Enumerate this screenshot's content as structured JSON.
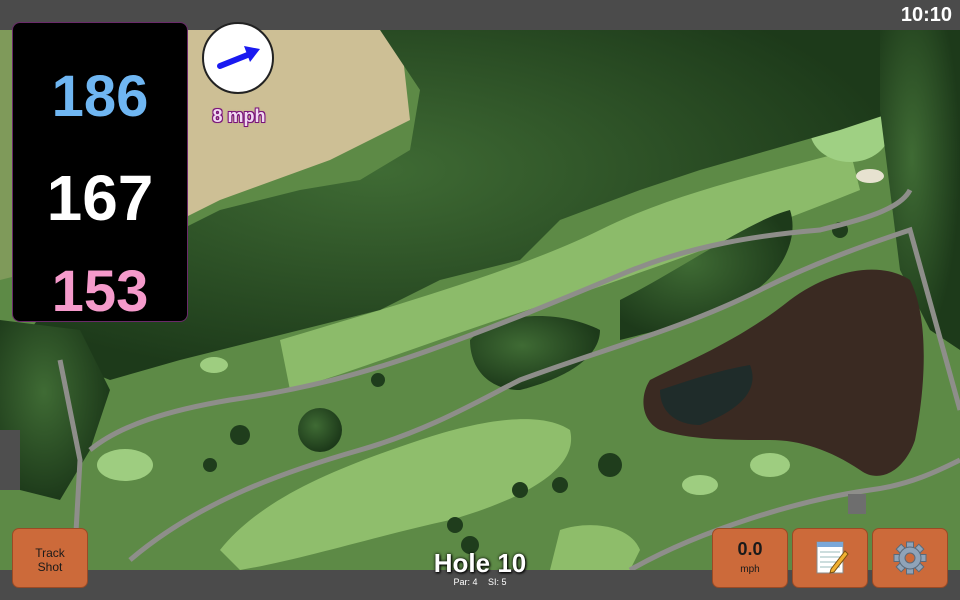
{
  "status": {
    "time": "10:10"
  },
  "distances": {
    "back": "186",
    "middle": "167",
    "front": "153"
  },
  "wind": {
    "speed": "8 mph",
    "icon": "arrow-right-icon"
  },
  "buttons": {
    "track_shot": [
      "Track",
      "Shot"
    ],
    "speed_value": "0.0",
    "speed_unit": "mph",
    "notes_icon": "notepad-icon",
    "settings_icon": "gear-icon"
  },
  "hole": {
    "title": "Hole 10",
    "par": "Par: 4",
    "si": "SI: 5"
  },
  "colors": {
    "back": "#6fb6f2",
    "middle": "#ffffff",
    "front": "#f59acb",
    "button": "#cc6a3a",
    "wind_arrow": "#1a1af0",
    "wind_text_outline": "#7a147a"
  }
}
